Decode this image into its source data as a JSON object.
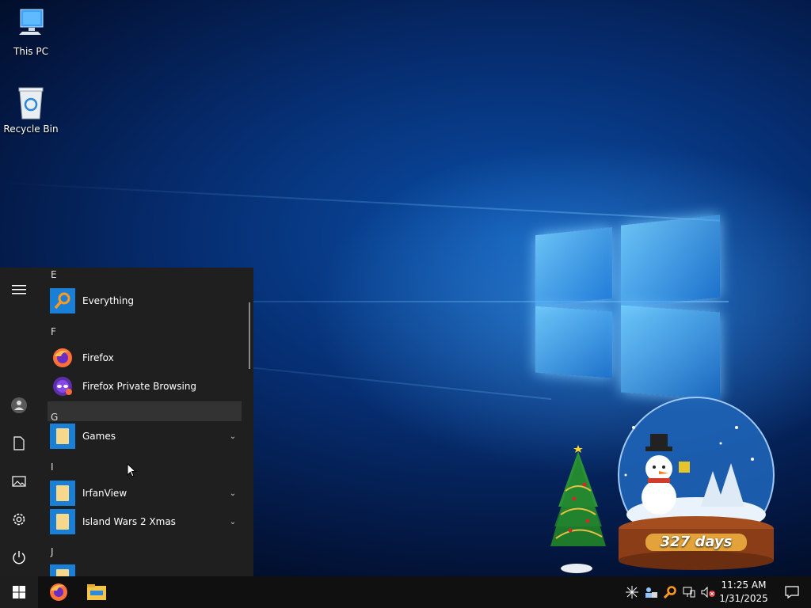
{
  "desktop": {
    "icons": [
      {
        "label": "This PC",
        "icon": "computer-icon"
      },
      {
        "label": "Recycle Bin",
        "icon": "recycle-bin-icon"
      }
    ]
  },
  "start_menu": {
    "rail": [
      "hamburger-menu-icon",
      "user-icon",
      "documents-icon",
      "pictures-icon",
      "settings-icon",
      "power-icon"
    ],
    "sections": [
      {
        "letter": "E",
        "apps": [
          {
            "label": "Everything",
            "icon": "everything-search-icon"
          }
        ]
      },
      {
        "letter": "F",
        "apps": [
          {
            "label": "Firefox",
            "icon": "firefox-icon"
          },
          {
            "label": "Firefox Private Browsing",
            "icon": "firefox-private-icon"
          }
        ]
      },
      {
        "letter": "G",
        "apps": [
          {
            "label": "Games",
            "icon": "folder-icon",
            "expandable": true
          }
        ]
      },
      {
        "letter": "I",
        "apps": [
          {
            "label": "IrfanView",
            "icon": "folder-icon",
            "expandable": true
          },
          {
            "label": "Island Wars 2 Xmas",
            "icon": "folder-icon",
            "expandable": true
          }
        ]
      },
      {
        "letter": "J",
        "apps": []
      }
    ]
  },
  "widget": {
    "countdown_text": "327 days"
  },
  "taskbar": {
    "pinned": [
      "windows-start-icon",
      "firefox-icon",
      "file-explorer-icon"
    ],
    "tray_icons": [
      "network-activity-icon",
      "user-network-icon",
      "search-tool-icon",
      "network-icon",
      "volume-muted-icon"
    ],
    "time": "11:25 AM",
    "date": "1/31/2025",
    "notifications_icon": "action-center-icon"
  },
  "colors": {
    "accent": "#1a7fd6",
    "menu_bg": "#1f1f1f",
    "taskbar_bg": "#101010",
    "highlight_row": "#333333"
  }
}
